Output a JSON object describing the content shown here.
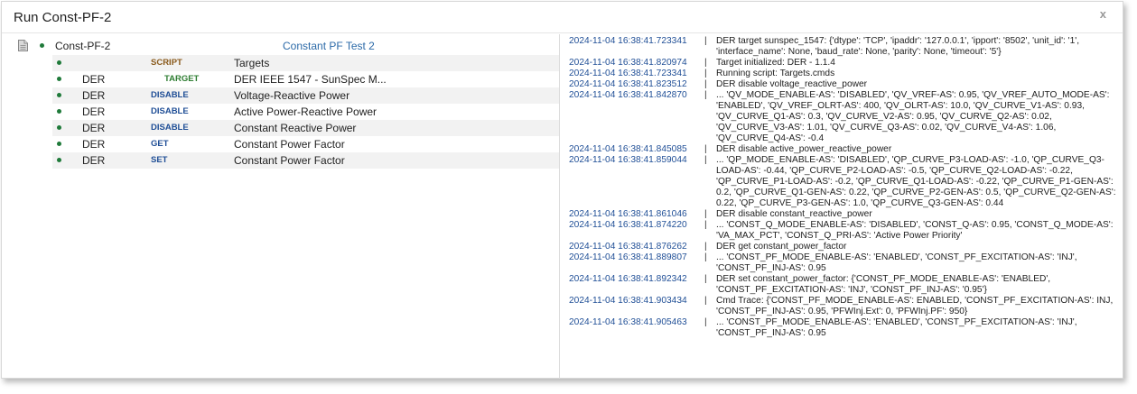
{
  "window": {
    "title": "Run Const-PF-2",
    "close_label": "x"
  },
  "tree": {
    "root_name": "Const-PF-2",
    "root_test": "Constant PF Test 2",
    "steps": [
      {
        "svc": "",
        "cmd": "SCRIPT",
        "cmd_type": "script",
        "desc": "Targets"
      },
      {
        "svc": "DER",
        "cmd": "TARGET",
        "cmd_type": "target",
        "desc": "DER IEEE 1547 - SunSpec M..."
      },
      {
        "svc": "DER",
        "cmd": "DISABLE",
        "cmd_type": "action",
        "desc": "Voltage-Reactive Power"
      },
      {
        "svc": "DER",
        "cmd": "DISABLE",
        "cmd_type": "action",
        "desc": "Active Power-Reactive Power"
      },
      {
        "svc": "DER",
        "cmd": "DISABLE",
        "cmd_type": "action",
        "desc": "Constant Reactive Power"
      },
      {
        "svc": "DER",
        "cmd": "GET",
        "cmd_type": "action",
        "desc": "Constant Power Factor"
      },
      {
        "svc": "DER",
        "cmd": "SET",
        "cmd_type": "action",
        "desc": "Constant Power Factor"
      }
    ]
  },
  "log": [
    {
      "ts": "2024-11-04 16:38:41.723341",
      "sep": "|",
      "msg": "DER target sunspec_1547: {'dtype': 'TCP', 'ipaddr': '127.0.0.1', 'ipport': '8502', 'unit_id': '1', 'interface_name': None, 'baud_rate': None, 'parity': None, 'timeout': '5'}"
    },
    {
      "ts": "2024-11-04 16:38:41.820974",
      "sep": "|",
      "msg": "Target initialized: DER - 1.1.4"
    },
    {
      "ts": "2024-11-04 16:38:41.723341",
      "sep": "|",
      "msg": "Running script: Targets.cmds"
    },
    {
      "ts": "2024-11-04 16:38:41.823512",
      "sep": "|",
      "msg": "DER disable voltage_reactive_power"
    },
    {
      "ts": "2024-11-04 16:38:41.842870",
      "sep": "|",
      "msg": "... 'QV_MODE_ENABLE-AS': 'DISABLED', 'QV_VREF-AS': 0.95, 'QV_VREF_AUTO_MODE-AS': 'ENABLED', 'QV_VREF_OLRT-AS': 400, 'QV_OLRT-AS': 10.0, 'QV_CURVE_V1-AS': 0.93, 'QV_CURVE_Q1-AS': 0.3, 'QV_CURVE_V2-AS': 0.95, 'QV_CURVE_Q2-AS': 0.02, 'QV_CURVE_V3-AS': 1.01, 'QV_CURVE_Q3-AS': 0.02, 'QV_CURVE_V4-AS': 1.06, 'QV_CURVE_Q4-AS': -0.4"
    },
    {
      "ts": "2024-11-04 16:38:41.845085",
      "sep": "|",
      "msg": "DER disable active_power_reactive_power"
    },
    {
      "ts": "2024-11-04 16:38:41.859044",
      "sep": "|",
      "msg": "... 'QP_MODE_ENABLE-AS': 'DISABLED', 'QP_CURVE_P3-LOAD-AS': -1.0, 'QP_CURVE_Q3-LOAD-AS': -0.44, 'QP_CURVE_P2-LOAD-AS': -0.5, 'QP_CURVE_Q2-LOAD-AS': -0.22, 'QP_CURVE_P1-LOAD-AS': -0.2, 'QP_CURVE_Q1-LOAD-AS': -0.22, 'QP_CURVE_P1-GEN-AS': 0.2, 'QP_CURVE_Q1-GEN-AS': 0.22, 'QP_CURVE_P2-GEN-AS': 0.5, 'QP_CURVE_Q2-GEN-AS': 0.22, 'QP_CURVE_P3-GEN-AS': 1.0, 'QP_CURVE_Q3-GEN-AS': 0.44"
    },
    {
      "ts": "2024-11-04 16:38:41.861046",
      "sep": "|",
      "msg": "DER disable constant_reactive_power"
    },
    {
      "ts": "2024-11-04 16:38:41.874220",
      "sep": "|",
      "msg": "... 'CONST_Q_MODE_ENABLE-AS': 'DISABLED', 'CONST_Q-AS': 0.95, 'CONST_Q_MODE-AS': 'VA_MAX_PCT', 'CONST_Q_PRI-AS': 'Active Power Priority'"
    },
    {
      "ts": "2024-11-04 16:38:41.876262",
      "sep": "|",
      "msg": "DER get constant_power_factor"
    },
    {
      "ts": "2024-11-04 16:38:41.889807",
      "sep": "|",
      "msg": "... 'CONST_PF_MODE_ENABLE-AS': 'ENABLED', 'CONST_PF_EXCITATION-AS': 'INJ', 'CONST_PF_INJ-AS': 0.95"
    },
    {
      "ts": "2024-11-04 16:38:41.892342",
      "sep": "|",
      "msg": "DER set constant_power_factor: {'CONST_PF_MODE_ENABLE-AS': 'ENABLED', 'CONST_PF_EXCITATION-AS': 'INJ', 'CONST_PF_INJ-AS': '0.95'}"
    },
    {
      "ts": "2024-11-04 16:38:41.903434",
      "sep": "|",
      "msg": "Cmd Trace: {'CONST_PF_MODE_ENABLE-AS': ENABLED, 'CONST_PF_EXCITATION-AS': INJ, 'CONST_PF_INJ-AS': 0.95, 'PFWInj.Ext': 0, 'PFWInj.PF': 950}"
    },
    {
      "ts": "2024-11-04 16:38:41.905463",
      "sep": "|",
      "msg": "... 'CONST_PF_MODE_ENABLE-AS': 'ENABLED', 'CONST_PF_EXCITATION-AS': 'INJ', 'CONST_PF_INJ-AS': 0.95"
    }
  ]
}
